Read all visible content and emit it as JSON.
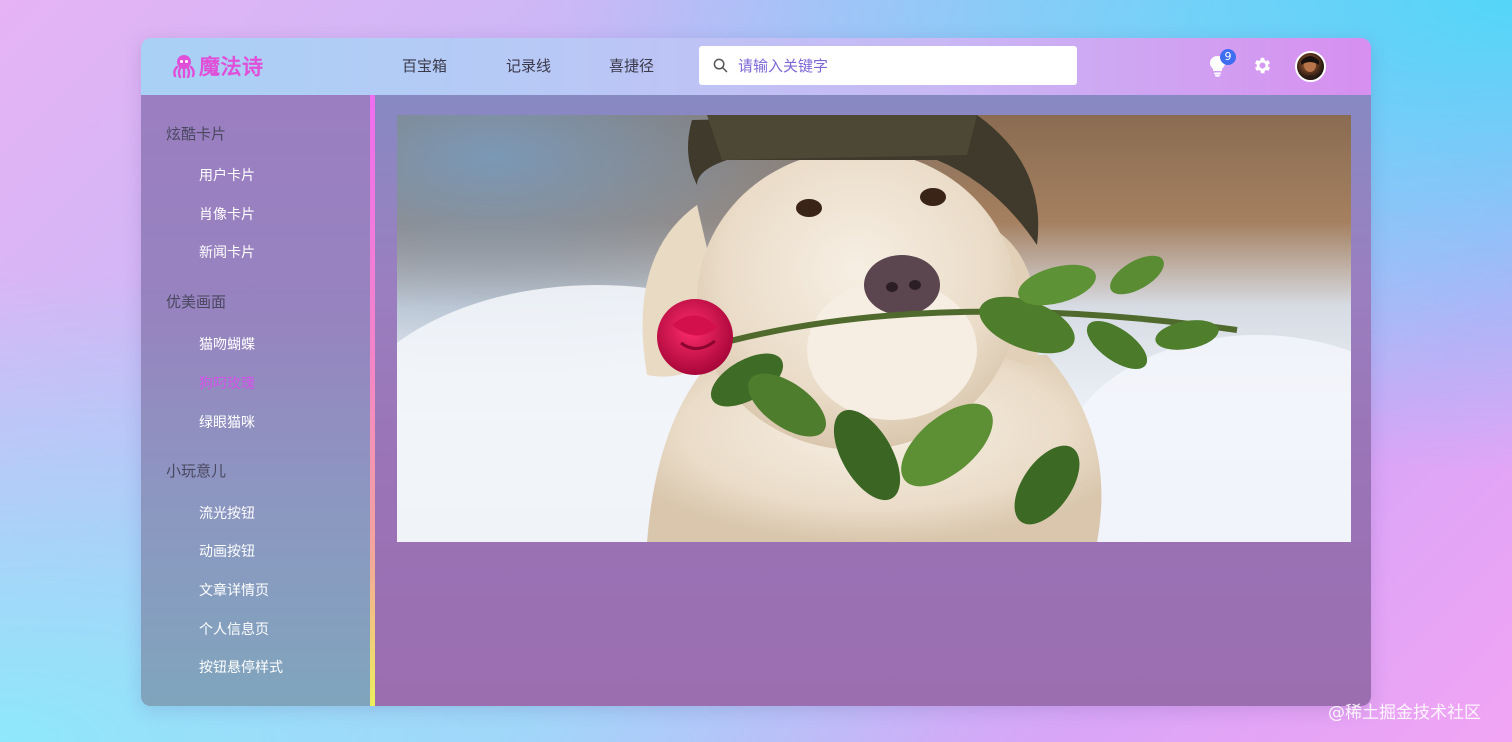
{
  "brand": {
    "name": "魔法诗",
    "color": "#e04fd8"
  },
  "header": {
    "nav": [
      "百宝箱",
      "记录线",
      "喜捷径"
    ],
    "search_placeholder": "请输入关键字",
    "notification_count": "9",
    "icons": [
      "search-icon",
      "lightbulb-icon",
      "gear-icon",
      "avatar"
    ]
  },
  "sidebar": {
    "groups": [
      {
        "title": "炫酷卡片",
        "items": [
          "用户卡片",
          "肖像卡片",
          "新闻卡片"
        ]
      },
      {
        "title": "优美画面",
        "items": [
          "猫吻蝴蝶",
          "狗叼玫瑰",
          "绿眼猫咪"
        ]
      },
      {
        "title": "小玩意儿",
        "items": [
          "流光按钮",
          "动画按钮",
          "文章详情页",
          "个人信息页",
          "按钮悬停样式"
        ]
      }
    ],
    "active_item": "狗叼玫瑰",
    "active_color": "#d451e8"
  },
  "main": {
    "image_subject": "white dog wearing a hat holding a red rose in its mouth"
  },
  "watermark": "@稀土掘金技术社区"
}
